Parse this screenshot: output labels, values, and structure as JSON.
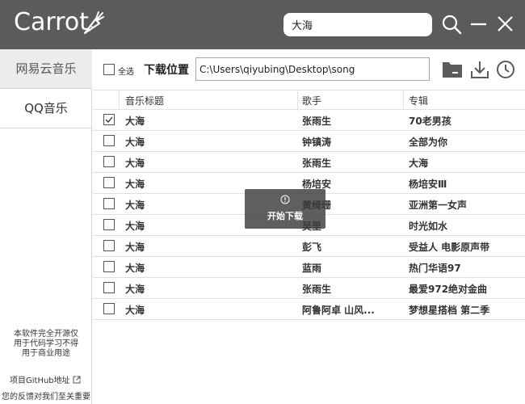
{
  "app": {
    "logo_text": "Carrot",
    "search_value": "大海",
    "colors": {
      "titlebar": "#5b5b5b",
      "sidebar_active": "#ececec",
      "toolbar_icon": "#5b5b5b"
    }
  },
  "titlebar": {
    "icons": [
      "carrot-logo-icon",
      "search-icon",
      "minimize-icon",
      "close-icon"
    ]
  },
  "sidebar": {
    "items": [
      {
        "label": "网易云音乐",
        "active": true
      },
      {
        "label": "QQ音乐",
        "active": false
      }
    ],
    "note": [
      "本软件完全开源仅",
      "用于代码学习不得",
      "用于商业用途"
    ],
    "github_link": "项目GitHub地址",
    "feedback": "您的反馈对我们至关重要"
  },
  "toolbar": {
    "select_all_label": "全选",
    "download_location_label": "下载位置",
    "path_value": "C:\\Users\\qiyubing\\Desktop\\song",
    "icons": [
      "folder-icon",
      "download-icon",
      "history-clock-icon"
    ]
  },
  "table": {
    "headers": [
      "音乐标题",
      "歌手",
      "专辑"
    ],
    "rows": [
      {
        "checked": true,
        "title": "大海",
        "artist": "张雨生",
        "album": "70老男孩"
      },
      {
        "checked": false,
        "title": "大海",
        "artist": "钟镇涛",
        "album": "全部为你"
      },
      {
        "checked": false,
        "title": "大海",
        "artist": "张雨生",
        "album": "大海"
      },
      {
        "checked": false,
        "title": "大海",
        "artist": "杨培安",
        "album": "杨培安Ⅲ"
      },
      {
        "checked": false,
        "title": "大海",
        "artist": "黄绮珊",
        "album": "亚洲第一女声"
      },
      {
        "checked": false,
        "title": "大海",
        "artist": "吴里",
        "album": "时光如水"
      },
      {
        "checked": false,
        "title": "大海",
        "artist": "彭飞",
        "album": "受益人 电影原声带"
      },
      {
        "checked": false,
        "title": "大海",
        "artist": "蓝雨",
        "album": "热门华语97"
      },
      {
        "checked": false,
        "title": "大海",
        "artist": "张雨生",
        "album": "最爱972绝对金曲"
      },
      {
        "checked": false,
        "title": "大海",
        "artist": "阿鲁阿卓 山风...",
        "album": "梦想星搭档 第二季"
      }
    ]
  },
  "toast": {
    "text": "开始下载",
    "icon": "info-circle-icon"
  }
}
